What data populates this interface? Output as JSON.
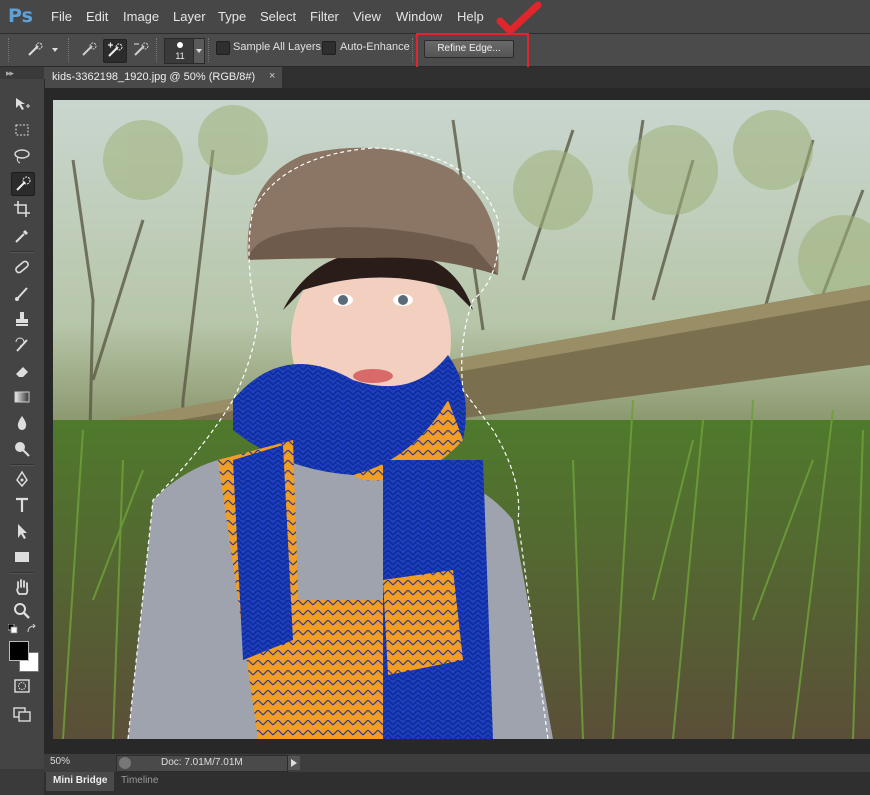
{
  "app": {
    "logo": "Ps",
    "accent_color": "#5fa2d8"
  },
  "menu": {
    "items": [
      "File",
      "Edit",
      "Image",
      "Layer",
      "Type",
      "Select",
      "Filter",
      "View",
      "Window",
      "Help"
    ]
  },
  "options_bar": {
    "brush_size": "11",
    "sample_all_layers_label": "Sample All Layers",
    "sample_all_layers_checked": false,
    "auto_enhance_label": "Auto-Enhance",
    "auto_enhance_checked": false,
    "refine_edge_label": "Refine Edge...",
    "highlight_color": "#e0262b"
  },
  "document": {
    "tab_title": "kids-3362198_1920.jpg @ 50% (RGB/8#)",
    "close_glyph": "×"
  },
  "toolbox": {
    "tools": [
      "move",
      "marquee",
      "lasso",
      "quick-selection",
      "crop",
      "eyedropper",
      "spot-healing",
      "brush",
      "clone-stamp",
      "history-brush",
      "eraser",
      "gradient",
      "blur",
      "dodge",
      "pen",
      "type",
      "path-selection",
      "rectangle",
      "hand",
      "zoom"
    ],
    "active_tool": "quick-selection",
    "foreground_color": "#000000",
    "background_color": "#ffffff"
  },
  "status_bar": {
    "zoom": "50%",
    "doc_info": "Doc: 7.01M/7.01M"
  },
  "bottom_panels": {
    "tabs": [
      "Mini Bridge",
      "Timeline"
    ],
    "active": "Mini Bridge"
  }
}
